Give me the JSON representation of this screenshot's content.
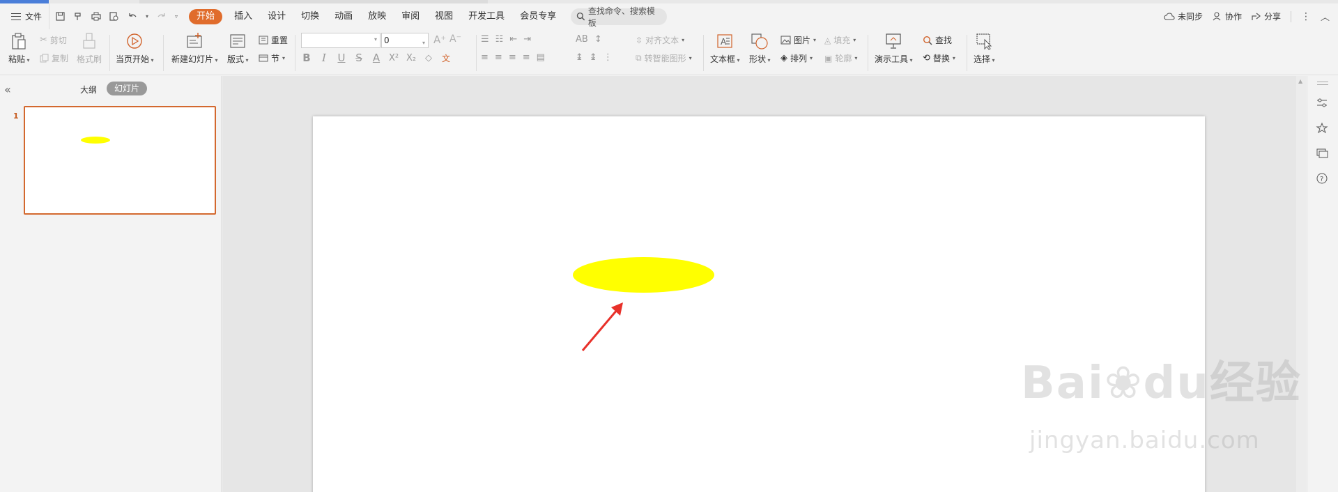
{
  "menubar": {
    "file_label": "文件",
    "tabs": [
      "开始",
      "插入",
      "设计",
      "切换",
      "动画",
      "放映",
      "审阅",
      "视图",
      "开发工具",
      "会员专享"
    ],
    "search_placeholder": "查找命令、搜索模板",
    "sync_label": "未同步",
    "collab_label": "协作",
    "share_label": "分享"
  },
  "ribbon": {
    "paste": "粘贴",
    "cut": "剪切",
    "copy": "复制",
    "format_painter": "格式刷",
    "start_from_current": "当页开始",
    "new_slide": "新建幻灯片",
    "layout": "版式",
    "reset": "重置",
    "section": "节",
    "font_size": "0",
    "align_text": "对齐文本",
    "smartart": "转智能图形",
    "textbox": "文本框",
    "shape": "形状",
    "picture": "图片",
    "fill": "填充",
    "arrange": "排列",
    "outline": "轮廓",
    "present_tools": "演示工具",
    "find": "查找",
    "replace": "替换",
    "select": "选择"
  },
  "leftpanel": {
    "outline_tab": "大纲",
    "slides_tab": "幻灯片",
    "slide_number": "1"
  },
  "colors": {
    "accent": "#e06c2c",
    "shape_fill": "#ffff00",
    "arrow": "#e8312a"
  },
  "watermark": {
    "brand_latin": "Bai",
    "brand_suffix": "du",
    "brand_cn": "经验",
    "url": "jingyan.baidu.com"
  }
}
